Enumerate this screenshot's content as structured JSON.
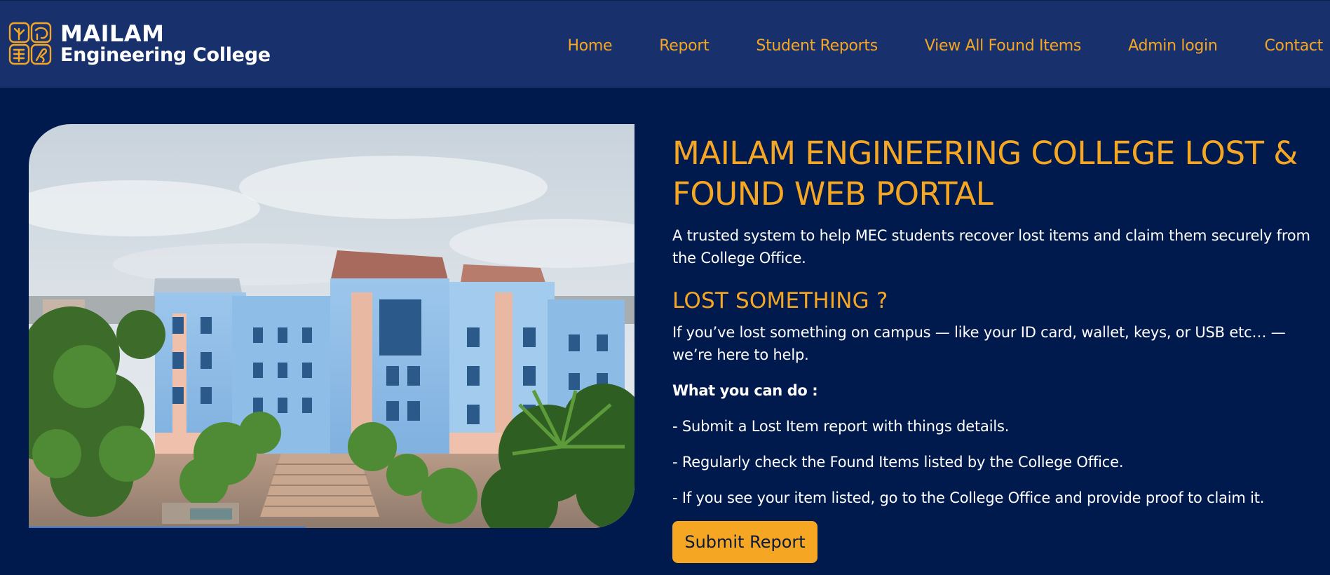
{
  "brand": {
    "name": "MAILAM",
    "subtitle": "Engineering College",
    "logo_icon": "college-logo-icon"
  },
  "nav": {
    "items": [
      {
        "label": "Home"
      },
      {
        "label": "Report"
      },
      {
        "label": "Student Reports"
      },
      {
        "label": "View All Found Items"
      },
      {
        "label": "Admin login"
      },
      {
        "label": "Contact"
      }
    ]
  },
  "hero": {
    "image_subject": "campus-building-photo"
  },
  "content": {
    "title": "MAILAM ENGINEERING COLLEGE LOST & FOUND WEB PORTAL",
    "tagline": "A trusted system to help MEC students recover lost items and claim them securely from the College Office.",
    "lost_heading": "LOST SOMETHING ?",
    "lost_text": "If you’ve lost something on campus — like your ID card, wallet, keys, or USB etc… — we’re here to help.",
    "what_heading": "What you can do :",
    "bullets": [
      "- Submit a Lost Item report with things details.",
      "- Regularly check the Found Items listed by the College Office.",
      "- If you see your item listed, go to the College Office and provide proof to claim it."
    ],
    "submit_label": "Submit Report"
  },
  "colors": {
    "page_background": "#001a4d",
    "navbar_background": "#18306b",
    "accent": "#f5a623",
    "text": "#ffffff"
  }
}
